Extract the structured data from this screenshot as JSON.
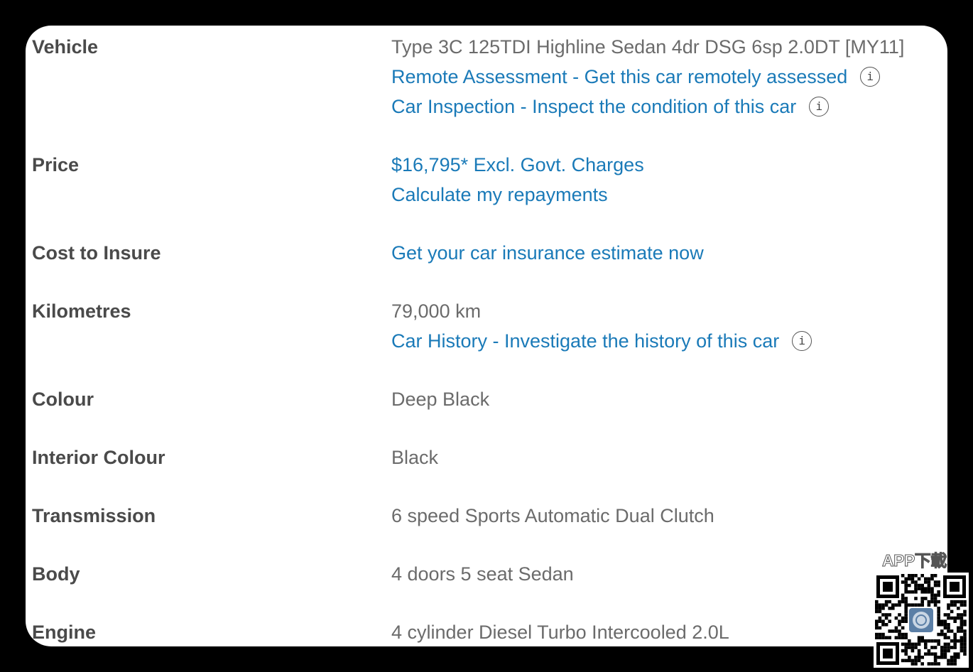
{
  "specs": {
    "vehicle": {
      "label": "Vehicle",
      "value": "Type 3C 125TDI Highline Sedan 4dr DSG 6sp 2.0DT [MY11]",
      "remote_assessment": "Remote Assessment - Get this car remotely assessed",
      "car_inspection": "Car Inspection - Inspect the condition of this car"
    },
    "price": {
      "label": "Price",
      "value": "$16,795* Excl. Govt. Charges",
      "repayments": "Calculate my repayments"
    },
    "insure": {
      "label": "Cost to Insure",
      "link": "Get your car insurance estimate now"
    },
    "kilometres": {
      "label": "Kilometres",
      "value": "79,000 km",
      "car_history": "Car History - Investigate the history of this car"
    },
    "colour": {
      "label": "Colour",
      "value": "Deep Black"
    },
    "interior_colour": {
      "label": "Interior Colour",
      "value": "Black"
    },
    "transmission": {
      "label": "Transmission",
      "value": "6 speed Sports Automatic Dual Clutch"
    },
    "body": {
      "label": "Body",
      "value": "4 doors 5 seat Sedan"
    },
    "engine": {
      "label": "Engine",
      "value": "4 cylinder Diesel Turbo Intercooled 2.0L"
    }
  },
  "overlay": {
    "app_download": "APP下載",
    "qr_icon": "qr-code-icon"
  },
  "colors": {
    "link": "#1a7ab8",
    "label": "#4a4a4a",
    "value": "#6b6b6b",
    "background": "#000000"
  },
  "icons": {
    "info": "i"
  }
}
